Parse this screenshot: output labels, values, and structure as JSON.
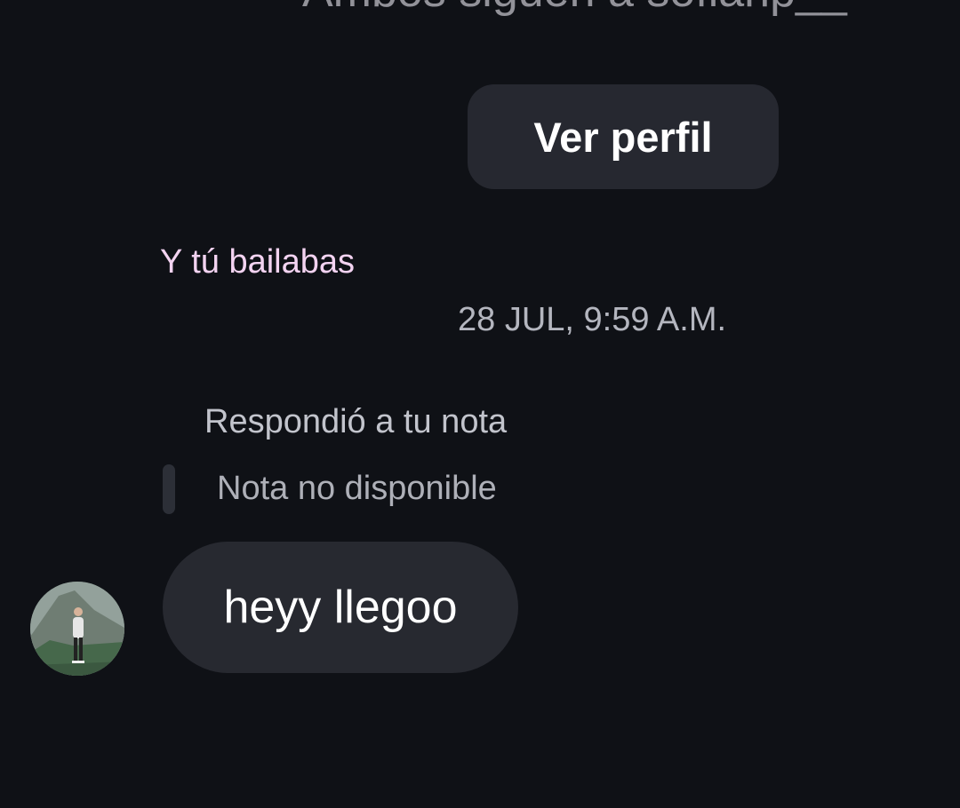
{
  "header": {
    "subtitle_partial": "Ambos siguen a sofiahp__"
  },
  "profile": {
    "view_profile_label": "Ver perfil"
  },
  "note": {
    "song": "Y tú bailabas"
  },
  "thread": {
    "timestamp": "28 JUL, 9:59 A.M.",
    "reply_caption": "Respondió a tu nota",
    "quoted_note": "Nota no disponible",
    "messages": [
      {
        "text": "heyy llegoo",
        "from": "other"
      }
    ]
  },
  "colors": {
    "background": "#0f1116",
    "bubble": "#272930",
    "song_text": "#f3d3f1",
    "muted_text": "#b4b6bf"
  }
}
